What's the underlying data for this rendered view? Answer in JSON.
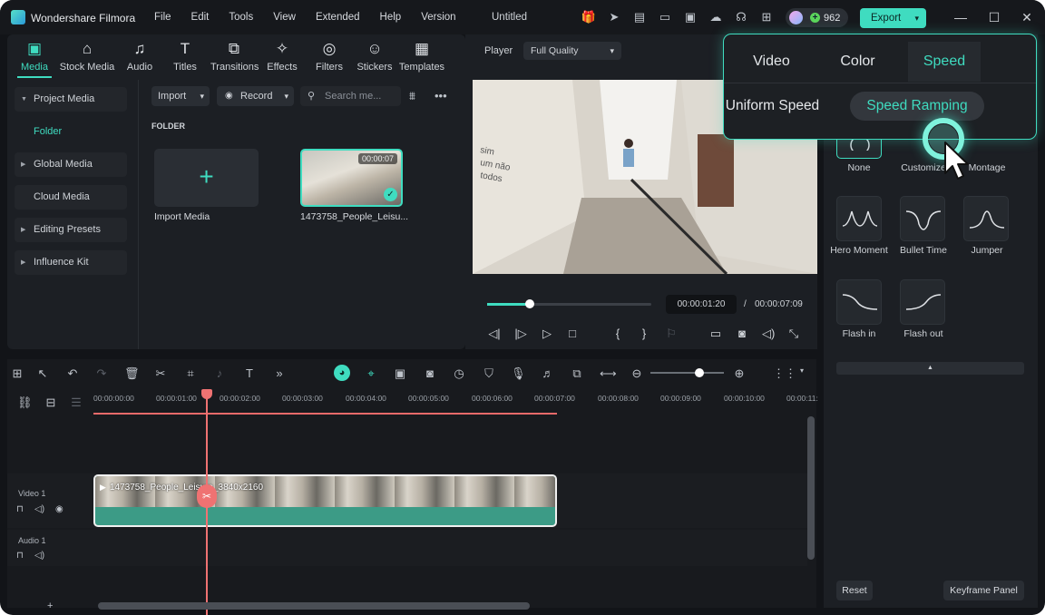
{
  "app": {
    "name": "Wondershare Filmora",
    "doc_title": "Untitled",
    "credits": "962",
    "export_label": "Export"
  },
  "menu": [
    "File",
    "Edit",
    "Tools",
    "View",
    "Extended",
    "Help",
    "Version"
  ],
  "tabs": [
    {
      "label": "Media",
      "icon": "media-icon",
      "active": true
    },
    {
      "label": "Stock Media",
      "icon": "stock-media-icon"
    },
    {
      "label": "Audio",
      "icon": "music-note-icon"
    },
    {
      "label": "Titles",
      "icon": "text-t-icon"
    },
    {
      "label": "Transitions",
      "icon": "transitions-icon"
    },
    {
      "label": "Effects",
      "icon": "sparkle-icon"
    },
    {
      "label": "Filters",
      "icon": "filter-icon"
    },
    {
      "label": "Stickers",
      "icon": "sticker-icon"
    },
    {
      "label": "Templates",
      "icon": "templates-icon"
    }
  ],
  "sidebar": [
    {
      "label": "Project Media",
      "arrow": "▼"
    },
    {
      "label": "Folder",
      "selected": true
    },
    {
      "label": "Global Media",
      "arrow": "▶"
    },
    {
      "label": "Cloud Media"
    },
    {
      "label": "Editing Presets",
      "arrow": "▶"
    },
    {
      "label": "Influence Kit",
      "arrow": "▶"
    }
  ],
  "media_toolbar": {
    "import": "Import",
    "record": "Record",
    "search_placeholder": "Search me..."
  },
  "folder_label": "FOLDER",
  "media_items": [
    {
      "label": "Import Media"
    },
    {
      "label": "1473758_People_Leisu...",
      "duration": "00:00:07"
    }
  ],
  "player": {
    "label": "Player",
    "quality": "Full Quality",
    "current_time": "00:00:01:20",
    "separator": "/",
    "total_time": "00:00:07:09",
    "progress": 0.26
  },
  "ruler": [
    "00:00:00:00",
    "00:00:01:00",
    "00:00:02:00",
    "00:00:03:00",
    "00:00:04:00",
    "00:00:05:00",
    "00:00:06:00",
    "00:00:07:00",
    "00:00:08:00",
    "00:00:09:00",
    "00:00:10:00",
    "00:00:11:"
  ],
  "tracks": {
    "video": "Video 1",
    "audio": "Audio 1"
  },
  "clip": {
    "label": "1473758_People_Leisure_3840x2160"
  },
  "speed_popup": {
    "tabs": [
      "Video",
      "Color",
      "Speed"
    ],
    "modes": [
      "Uniform Speed",
      "Speed Ramping"
    ]
  },
  "presets": [
    "None",
    "Customize",
    "Montage",
    "Hero Moment",
    "Bullet Time",
    "Jumper",
    "Flash in",
    "Flash out"
  ],
  "right_buttons": {
    "reset": "Reset",
    "keyframe": "Keyframe Panel"
  },
  "colors": {
    "accent": "#3fdcc0",
    "playhead": "#ef7272",
    "clip": "#3c9b86"
  }
}
